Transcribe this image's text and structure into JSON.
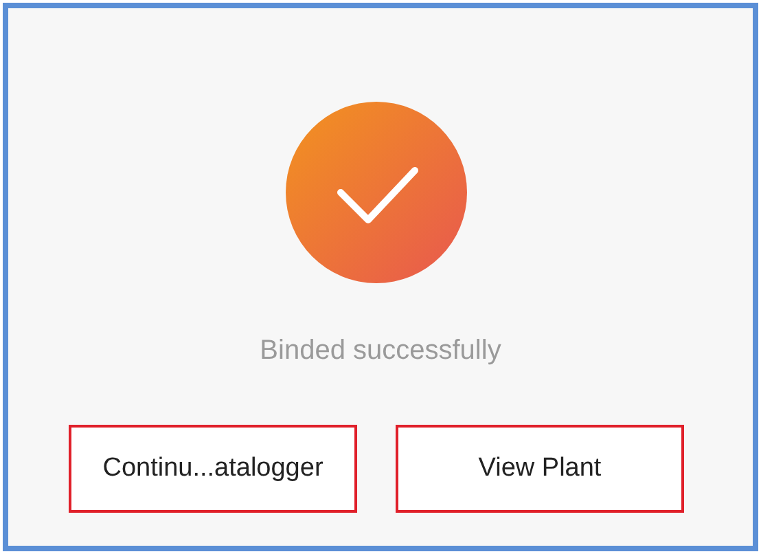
{
  "status": {
    "message": "Binded successfully"
  },
  "buttons": [
    {
      "label": "Continu...atalogger"
    },
    {
      "label": "View Plant"
    }
  ]
}
